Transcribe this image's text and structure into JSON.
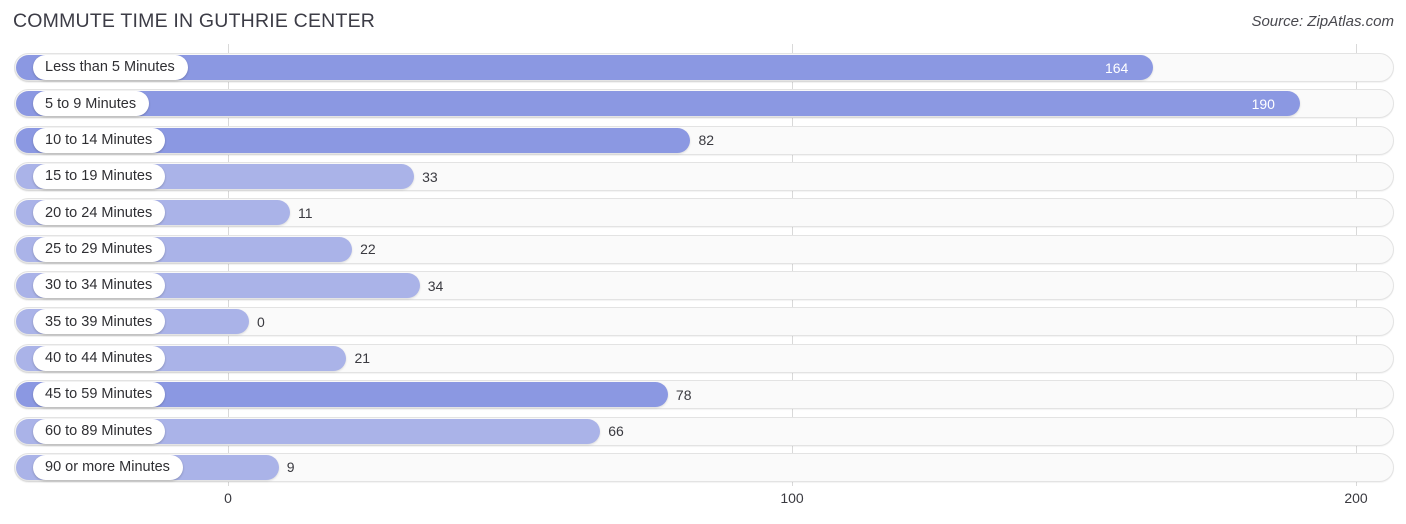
{
  "header": {
    "title": "COMMUTE TIME IN GUTHRIE CENTER",
    "source": "Source: ZipAtlas.com"
  },
  "colors": {
    "bar_primary": "#8b98e2",
    "bar_light": "#aab3e8",
    "track": "#fafafa",
    "gridline": "#d9d9d9",
    "text": "#3a3a40"
  },
  "chart_data": {
    "type": "bar",
    "orientation": "horizontal",
    "title": "COMMUTE TIME IN GUTHRIE CENTER",
    "xlabel": "",
    "ylabel": "",
    "xlim": [
      0,
      200
    ],
    "ticks": [
      0,
      100,
      200
    ],
    "tick_labels": [
      "0",
      "100",
      "200"
    ],
    "grid": true,
    "legend": false,
    "categories": [
      "Less than 5 Minutes",
      "5 to 9 Minutes",
      "10 to 14 Minutes",
      "15 to 19 Minutes",
      "20 to 24 Minutes",
      "25 to 29 Minutes",
      "30 to 34 Minutes",
      "35 to 39 Minutes",
      "40 to 44 Minutes",
      "45 to 59 Minutes",
      "60 to 89 Minutes",
      "90 or more Minutes"
    ],
    "values": [
      164,
      190,
      82,
      33,
      11,
      22,
      34,
      0,
      21,
      78,
      66,
      9
    ],
    "value_labels": [
      "164",
      "190",
      "82",
      "33",
      "11",
      "22",
      "34",
      "0",
      "21",
      "78",
      "66",
      "9"
    ]
  },
  "rows": [
    {
      "label": "Less than 5 Minutes",
      "value": 164,
      "value_label": "164",
      "inside": true,
      "light": false
    },
    {
      "label": "5 to 9 Minutes",
      "value": 190,
      "value_label": "190",
      "inside": true,
      "light": false
    },
    {
      "label": "10 to 14 Minutes",
      "value": 82,
      "value_label": "82",
      "inside": false,
      "light": false
    },
    {
      "label": "15 to 19 Minutes",
      "value": 33,
      "value_label": "33",
      "inside": false,
      "light": true
    },
    {
      "label": "20 to 24 Minutes",
      "value": 11,
      "value_label": "11",
      "inside": false,
      "light": true
    },
    {
      "label": "25 to 29 Minutes",
      "value": 22,
      "value_label": "22",
      "inside": false,
      "light": true
    },
    {
      "label": "30 to 34 Minutes",
      "value": 34,
      "value_label": "34",
      "inside": false,
      "light": true
    },
    {
      "label": "35 to 39 Minutes",
      "value": 0,
      "value_label": "0",
      "inside": false,
      "light": true
    },
    {
      "label": "40 to 44 Minutes",
      "value": 21,
      "value_label": "21",
      "inside": false,
      "light": true
    },
    {
      "label": "45 to 59 Minutes",
      "value": 78,
      "value_label": "78",
      "inside": false,
      "light": false
    },
    {
      "label": "60 to 89 Minutes",
      "value": 66,
      "value_label": "66",
      "inside": false,
      "light": true
    },
    {
      "label": "90 or more Minutes",
      "value": 9,
      "value_label": "9",
      "inside": false,
      "light": true
    }
  ],
  "axis": {
    "ticks": [
      {
        "label": "0",
        "value": 0
      },
      {
        "label": "100",
        "value": 100
      },
      {
        "label": "200",
        "value": 200
      }
    ]
  }
}
